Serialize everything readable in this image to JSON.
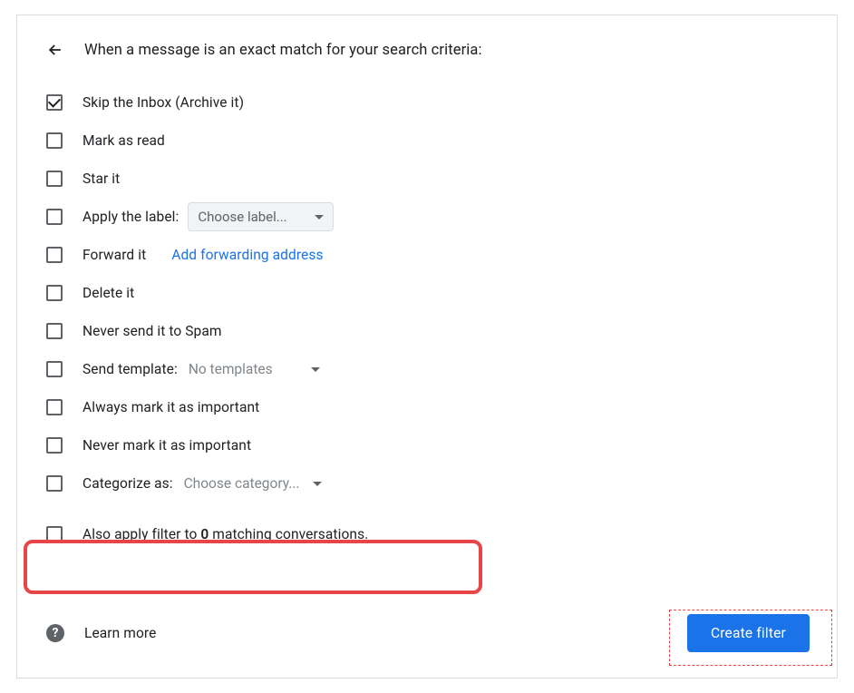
{
  "header": {
    "title": "When a message is an exact match for your search criteria:"
  },
  "options": {
    "skip_inbox": "Skip the Inbox (Archive it)",
    "mark_read": "Mark as read",
    "star_it": "Star it",
    "apply_label": "Apply the label:",
    "apply_label_select": "Choose label...",
    "forward_it": "Forward it",
    "forward_link": "Add forwarding address",
    "delete_it": "Delete it",
    "never_spam": "Never send it to Spam",
    "send_template": "Send template:",
    "send_template_select": "No templates",
    "always_important": "Always mark it as important",
    "never_important": "Never mark it as important",
    "categorize": "Categorize as:",
    "categorize_select": "Choose category...",
    "also_apply_prefix": "Also apply filter to ",
    "also_apply_count": "0",
    "also_apply_suffix": " matching conversations."
  },
  "footer": {
    "learn_more": "Learn more",
    "create_filter": "Create filter"
  }
}
